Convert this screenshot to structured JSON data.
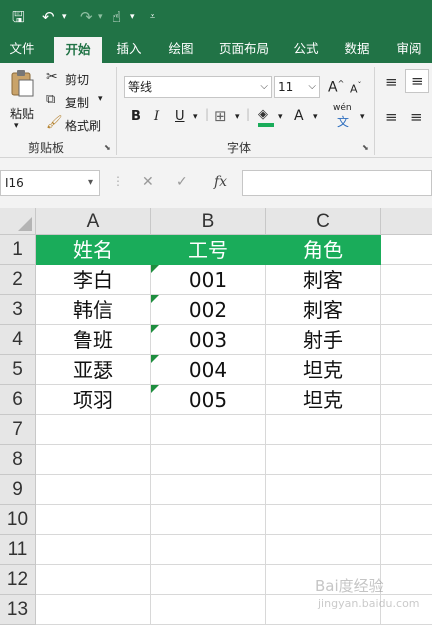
{
  "quick_access": {
    "save_icon": "save-icon",
    "undo_icon": "undo-icon",
    "redo_icon": "redo-icon",
    "touch_icon": "touch-mode-icon",
    "customize_icon": "customize-icon"
  },
  "tabs": [
    "文件",
    "开始",
    "插入",
    "绘图",
    "页面布局",
    "公式",
    "数据",
    "审阅"
  ],
  "active_tab": "开始",
  "clipboard": {
    "paste_label": "粘贴",
    "cut_label": "剪切",
    "copy_label": "复制",
    "format_painter_label": "格式刷",
    "group_label": "剪贴板"
  },
  "font": {
    "font_name": "等线",
    "font_size": "11",
    "increase_size": "A",
    "decrease_size": "A",
    "bold": "B",
    "italic": "I",
    "underline": "U",
    "font_color": "A",
    "phonetic": "wén",
    "phonetic_sub": "文",
    "group_label": "字体"
  },
  "formula_bar": {
    "name_box": "I16",
    "cancel": "✕",
    "enter": "✓",
    "fx": "fx",
    "formula": ""
  },
  "sheet": {
    "columns": [
      "A",
      "B",
      "C"
    ],
    "rows": [
      "1",
      "2",
      "3",
      "4",
      "5",
      "6",
      "7",
      "8",
      "9",
      "10",
      "11",
      "12",
      "13"
    ],
    "header_row": [
      "姓名",
      "工号",
      "角色"
    ],
    "data": [
      [
        "李白",
        "001",
        "刺客"
      ],
      [
        "韩信",
        "002",
        "刺客"
      ],
      [
        "鲁班",
        "003",
        "射手"
      ],
      [
        "亚瑟",
        "004",
        "坦克"
      ],
      [
        "项羽",
        "005",
        "坦克"
      ]
    ],
    "header_color": "#1aac5a",
    "text_number_indicator_color": "#1e8e3e"
  },
  "watermark": {
    "text": "Bai度经验",
    "sub": "jingyan.baidu.com"
  },
  "colors": {
    "accent": "#217346",
    "ribbon_bg": "#f3f3f3"
  }
}
